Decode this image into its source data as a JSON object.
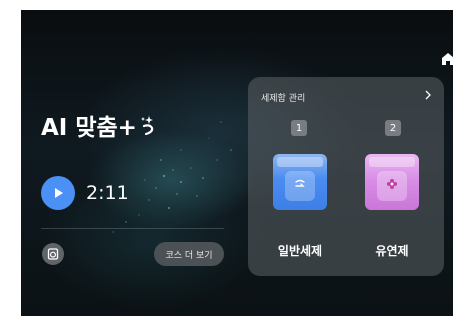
{
  "main": {
    "title": "AI 맞춤+",
    "time": "2:11",
    "more_course_label": "코스 더 보기"
  },
  "panel": {
    "title": "세제함 관리",
    "slots": [
      {
        "number": "1",
        "label": "일반세제",
        "color": "#4a8cf0",
        "icon": "detergent-swirl-icon"
      },
      {
        "number": "2",
        "label": "유연제",
        "color": "#d98ee6",
        "icon": "softener-flower-icon"
      }
    ]
  },
  "colors": {
    "accent": "#4a90f5",
    "detergent": "#4a8cf0",
    "softener": "#d98ee6"
  }
}
